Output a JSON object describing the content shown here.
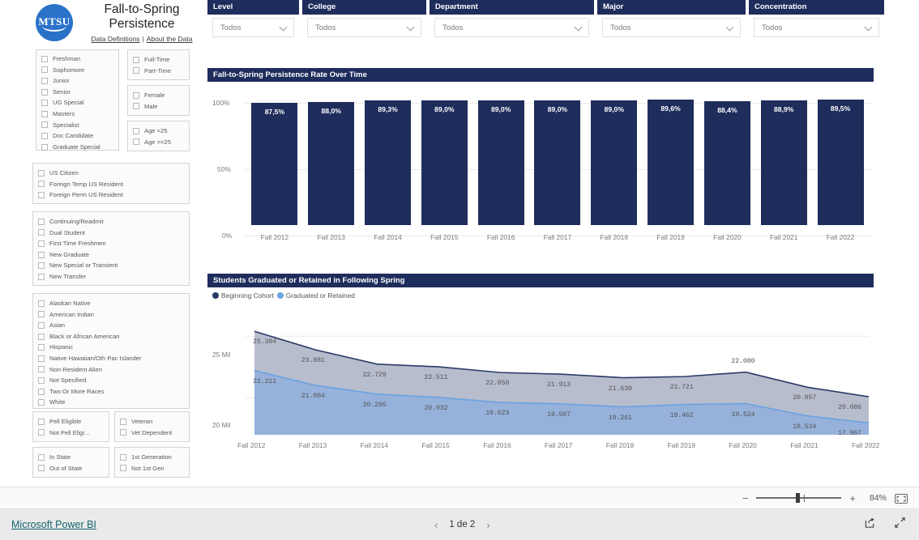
{
  "header": {
    "logo_text": "MTSU",
    "title_line1": "Fall-to-Spring",
    "title_line2": "Persistence",
    "link_data_definitions": "Data Definitions",
    "link_separator": "|",
    "link_about": "About the Data"
  },
  "slicers": [
    {
      "name": "level",
      "items": [
        "Freshman",
        "Sophomore",
        "Junior",
        "Senior",
        "UG Special",
        "Masters",
        "Specialist",
        "Doc Candidate",
        "Graduate Special"
      ]
    },
    {
      "name": "enrollment-status",
      "items": [
        "Full-Time",
        "Part-Time"
      ]
    },
    {
      "name": "gender",
      "items": [
        "Female",
        "Male"
      ]
    },
    {
      "name": "age",
      "items": [
        "Age <25",
        "Age >=25"
      ]
    },
    {
      "name": "citizenship",
      "items": [
        "US Citizen",
        "Foreign Temp US Resident",
        "Foreign Perm US Resident"
      ]
    },
    {
      "name": "student-type",
      "items": [
        "Continuing/Readmit",
        "Dual Student",
        "First Time Freshmen",
        "New Graduate",
        "New Special or Transient",
        "New Transfer"
      ]
    },
    {
      "name": "ethnicity",
      "items": [
        "Alaskan Native",
        "American Indian",
        "Asian",
        "Black or African American",
        "Hispanic",
        "Native Hawaiian/Oth Pac Islander",
        "Non-Resident Alien",
        "Not Specified",
        "Two Or More Races",
        "White"
      ]
    },
    {
      "name": "pell",
      "items": [
        "Pell Eligible",
        "Not Pell Eligi..."
      ]
    },
    {
      "name": "veteran",
      "items": [
        "Veteran",
        "Vet Dependent"
      ]
    },
    {
      "name": "residency",
      "items": [
        "In State",
        "Out of State"
      ]
    },
    {
      "name": "generation",
      "items": [
        "1st Generation",
        "Not 1st Gen"
      ]
    }
  ],
  "filters": [
    {
      "label": "Level",
      "value": "Todos"
    },
    {
      "label": "College",
      "value": "Todos"
    },
    {
      "label": "Department",
      "value": "Todos"
    },
    {
      "label": "Major",
      "value": "Todos"
    },
    {
      "label": "Concentration",
      "value": "Todos"
    }
  ],
  "chart_data": [
    {
      "type": "bar",
      "title": "Fall-to-Spring Persistence Rate Over Time",
      "categories": [
        "Fall 2012",
        "Fall 2013",
        "Fall 2014",
        "Fall 2015",
        "Fall 2016",
        "Fall 2017",
        "Fall 2018",
        "Fall 2019",
        "Fall 2020",
        "Fall 2021",
        "Fall 2022"
      ],
      "values": [
        87.5,
        88.0,
        89.3,
        89.0,
        89.0,
        89.0,
        89.0,
        89.6,
        88.4,
        88.9,
        89.5
      ],
      "labels": [
        "87,5%",
        "88,0%",
        "89,3%",
        "89,0%",
        "89,0%",
        "89,0%",
        "89,0%",
        "89,6%",
        "88,4%",
        "88,9%",
        "89,5%"
      ],
      "xlabel": "",
      "ylabel": "",
      "ylim": [
        0,
        100
      ],
      "ytick_labels": [
        "100%",
        "50%",
        "0%"
      ],
      "ytick_values": [
        100,
        50,
        0
      ],
      "grid": true,
      "series_color": "#1f2d5c"
    },
    {
      "type": "area",
      "title": "Students Graduated or Retained in Following Spring",
      "categories": [
        "Fall 2012",
        "Fall 2013",
        "Fall 2014",
        "Fall 2015",
        "Fall 2016",
        "Fall 2017",
        "Fall 2018",
        "Fall 2019",
        "Fall 2020",
        "Fall 2021",
        "Fall 2022"
      ],
      "series": [
        {
          "name": "Beginning Cohort",
          "color": "#2b3a67",
          "values": [
            25394,
            23881,
            22729,
            22511,
            22050,
            21913,
            21630,
            21721,
            22080,
            20857,
            20086
          ],
          "labels": [
            "25.394",
            "23.881",
            "22.729",
            "22.511",
            "22.050",
            "21.913",
            "21.630",
            "21.721",
            "22.080",
            "20.857",
            "20.086"
          ]
        },
        {
          "name": "Graduated or Retained",
          "color": "#6aa3e0",
          "values": [
            22211,
            21004,
            20295,
            20032,
            19623,
            19507,
            19261,
            19462,
            19524,
            18534,
            17967
          ],
          "labels": [
            "22.211",
            "21.004",
            "20.295",
            "20.032",
            "19.623",
            "19.507",
            "19.261",
            "19.462",
            "19.524",
            "18.534",
            "17.967"
          ]
        }
      ],
      "xlabel": "",
      "ylabel": "",
      "ylim": [
        17000,
        26000
      ],
      "ytick_labels": [
        "25 Mil",
        "20 Mil"
      ],
      "ytick_values": [
        25000,
        20000
      ],
      "grid": true,
      "legend_position": "top-left"
    }
  ],
  "zoombar": {
    "minus": "−",
    "plus": "+",
    "percent": "84%",
    "fit_icon": "fit-to-page-icon"
  },
  "footer": {
    "brand": "Microsoft Power BI",
    "prev_icon": "‹",
    "next_icon": "›",
    "page_text": "1 de 2",
    "share_icon": "share-icon",
    "fullscreen_icon": "fullscreen-icon"
  },
  "colors": {
    "navy": "#1f2d5c",
    "light_blue": "#96b1da",
    "brand_link": "#10656d"
  }
}
